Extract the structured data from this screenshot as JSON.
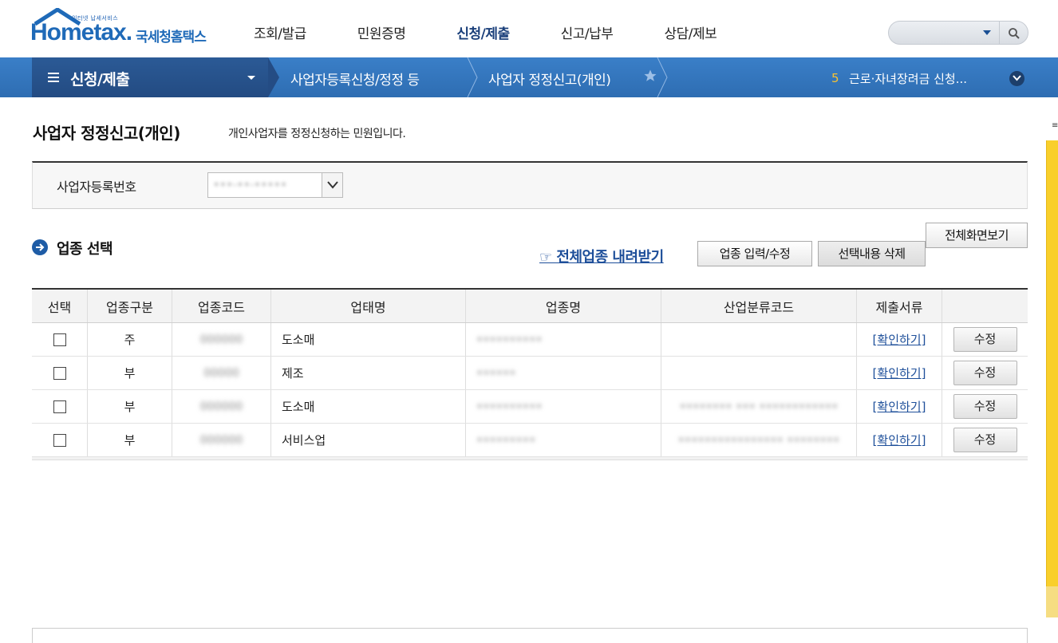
{
  "logo": {
    "tag": "인터넷 납세서비스",
    "brand": "Hometax.",
    "sub": "국세청홈택스"
  },
  "topnav": [
    {
      "label": "조회/발급"
    },
    {
      "label": "민원증명"
    },
    {
      "label": "신청/제출"
    },
    {
      "label": "신고/납부"
    },
    {
      "label": "상담/제보"
    }
  ],
  "search": {
    "placeholder": ""
  },
  "breadcrumb": {
    "title": "신청/제출",
    "items": [
      "사업자등록신청/정정 등",
      "사업자 정정신고(개인)"
    ]
  },
  "notice": {
    "num": "5",
    "text": "근로·자녀장려금 신청..."
  },
  "page": {
    "title": "사업자 정정신고(개인)",
    "desc": "개인사업자를 정정신청하는 민원입니다."
  },
  "biz": {
    "label": "사업자등록번호",
    "value": "•••-••-•••••"
  },
  "section": {
    "title": "업종 선택"
  },
  "actions": {
    "fullscreen": "전체화면보기",
    "download": "☞ 전체업종 내려받기",
    "edit_industry": "업종 입력/수정",
    "delete_selected": "선택내용 삭제"
  },
  "table": {
    "headers": [
      "선택",
      "업종구분",
      "업종코드",
      "업태명",
      "업종명",
      "산업분류코드",
      "제출서류",
      ""
    ],
    "rows": [
      {
        "type": "주",
        "code": "000000",
        "biz_type": "도소매",
        "industry": "••••••••••",
        "class_code": "",
        "doc": "[확인하기]",
        "edit": "수정"
      },
      {
        "type": "부",
        "code": "00000",
        "biz_type": "제조",
        "industry": "••••••",
        "class_code": "",
        "doc": "[확인하기]",
        "edit": "수정"
      },
      {
        "type": "부",
        "code": "000000",
        "biz_type": "도소매",
        "industry": "••••••••••",
        "class_code": "•••••••• ••• ••••••••••••",
        "doc": "[확인하기]",
        "edit": "수정"
      },
      {
        "type": "부",
        "code": "000000",
        "biz_type": "서비스업",
        "industry": "•••••••••",
        "class_code": "•••••••••••••••• ••••••••",
        "doc": "[확인하기]",
        "edit": "수정"
      }
    ]
  },
  "colors": {
    "brand": "#1f6ab8",
    "bar": "#3a7fc8",
    "bar_dark": "#234b82",
    "side": "#f9cf2b"
  }
}
